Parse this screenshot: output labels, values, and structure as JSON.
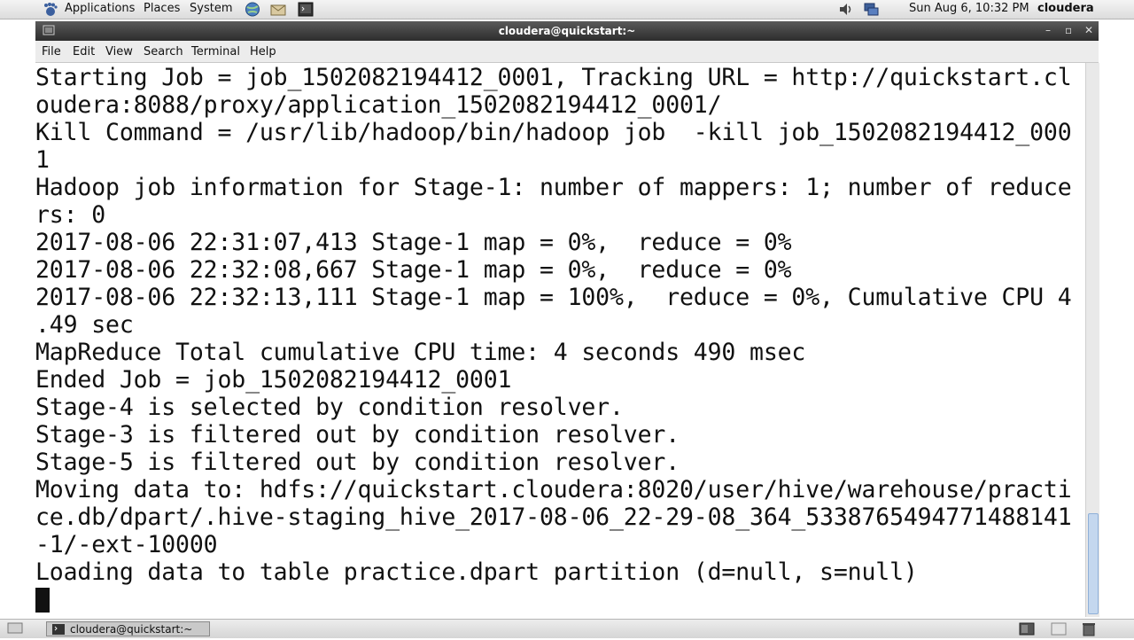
{
  "top_panel": {
    "menus": [
      "Applications",
      "Places",
      "System"
    ],
    "clock": "Sun Aug  6, 10:32 PM",
    "user": "cloudera",
    "icons": [
      "gnome-foot-icon",
      "globe-icon",
      "mail-icon",
      "terminal-icon",
      "volume-icon",
      "network-icon"
    ]
  },
  "window": {
    "title": "cloudera@quickstart:~",
    "controls": [
      "–",
      "▫",
      "✕"
    ],
    "menu": [
      "File",
      "Edit",
      "View",
      "Search",
      "Terminal",
      "Help"
    ]
  },
  "terminal": {
    "lines": [
      "Starting Job = job_1502082194412_0001, Tracking URL = http://quickstart.cl",
      "oudera:8088/proxy/application_1502082194412_0001/",
      "Kill Command = /usr/lib/hadoop/bin/hadoop job  -kill job_1502082194412_000",
      "1",
      "Hadoop job information for Stage-1: number of mappers: 1; number of reduce",
      "rs: 0",
      "2017-08-06 22:31:07,413 Stage-1 map = 0%,  reduce = 0%",
      "2017-08-06 22:32:08,667 Stage-1 map = 0%,  reduce = 0%",
      "2017-08-06 22:32:13,111 Stage-1 map = 100%,  reduce = 0%, Cumulative CPU 4",
      ".49 sec",
      "MapReduce Total cumulative CPU time: 4 seconds 490 msec",
      "Ended Job = job_1502082194412_0001",
      "Stage-4 is selected by condition resolver.",
      "Stage-3 is filtered out by condition resolver.",
      "Stage-5 is filtered out by condition resolver.",
      "Moving data to: hdfs://quickstart.cloudera:8020/user/hive/warehouse/practi",
      "ce.db/dpart/.hive-staging_hive_2017-08-06_22-29-08_364_5338765494771488141",
      "-1/-ext-10000",
      "Loading data to table practice.dpart partition (d=null, s=null)"
    ]
  },
  "taskbar": {
    "window_button_label": "cloudera@quickstart:~"
  }
}
